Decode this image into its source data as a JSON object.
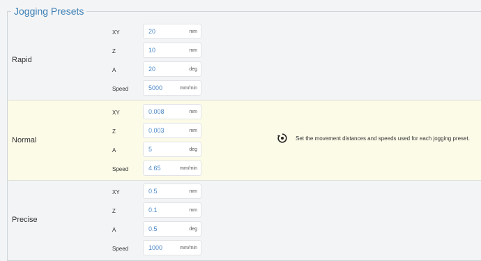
{
  "title": "Jogging Presets",
  "hint": "Set the movement distances and speeds used for each jogging preset.",
  "presets": [
    {
      "name": "Rapid",
      "rows": [
        {
          "label": "XY",
          "value": "20",
          "unit": "mm"
        },
        {
          "label": "Z",
          "value": "10",
          "unit": "mm"
        },
        {
          "label": "A",
          "value": "20",
          "unit": "deg"
        },
        {
          "label": "Speed",
          "value": "5000",
          "unit": "mm/min"
        }
      ]
    },
    {
      "name": "Normal",
      "rows": [
        {
          "label": "XY",
          "value": "0.008",
          "unit": "mm"
        },
        {
          "label": "Z",
          "value": "0.003",
          "unit": "mm"
        },
        {
          "label": "A",
          "value": "5",
          "unit": "deg"
        },
        {
          "label": "Speed",
          "value": "4.65",
          "unit": "mm/min"
        }
      ]
    },
    {
      "name": "Precise",
      "rows": [
        {
          "label": "XY",
          "value": "0.5",
          "unit": "mm"
        },
        {
          "label": "Z",
          "value": "0.1",
          "unit": "mm"
        },
        {
          "label": "A",
          "value": "0.5",
          "unit": "deg"
        },
        {
          "label": "Speed",
          "value": "1000",
          "unit": "mm/min"
        }
      ]
    }
  ]
}
